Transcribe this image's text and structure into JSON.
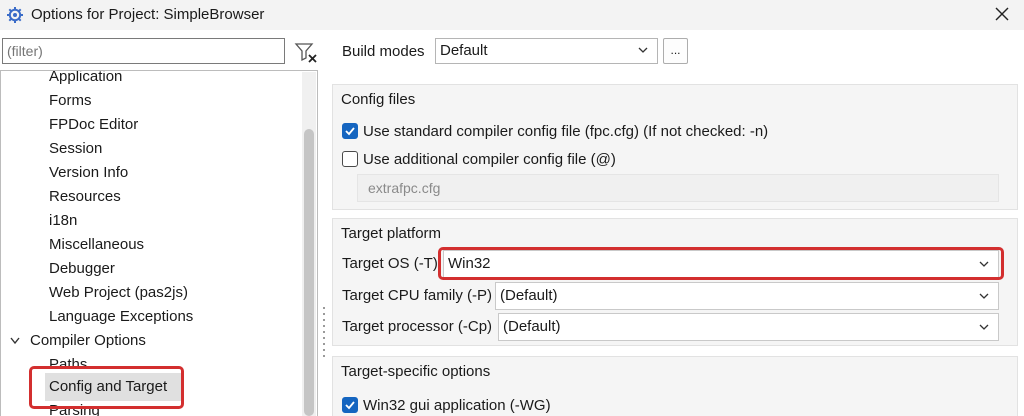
{
  "window": {
    "title": "Options for Project: SimpleBrowser"
  },
  "filter": {
    "placeholder": "(filter)"
  },
  "tree": {
    "items": [
      "Application",
      "Forms",
      "FPDoc Editor",
      "Session",
      "Version Info",
      "Resources",
      "i18n",
      "Miscellaneous",
      "Debugger",
      "Web Project (pas2js)",
      "Language Exceptions",
      "Compiler Options",
      "Paths",
      "Config and Target",
      "Parsing"
    ],
    "selected": "Config and Target"
  },
  "build_modes": {
    "label": "Build modes",
    "value": "Default",
    "more_label": "..."
  },
  "config_files": {
    "title": "Config files",
    "use_standard": {
      "label": "Use standard compiler config file (fpc.cfg) (If not checked: -n)",
      "checked": true
    },
    "use_additional": {
      "label": "Use additional compiler config file (@)",
      "checked": false
    },
    "additional_value": "extrafpc.cfg"
  },
  "target_platform": {
    "title": "Target platform",
    "os": {
      "label": "Target OS (-T)",
      "value": "Win32"
    },
    "cpu": {
      "label": "Target CPU family (-P)",
      "value": "(Default)"
    },
    "processor": {
      "label": "Target processor (-Cp)",
      "value": "(Default)"
    }
  },
  "target_specific": {
    "title": "Target-specific options",
    "win32_gui": {
      "label": "Win32 gui application (-WG)",
      "checked": true
    }
  },
  "colors": {
    "highlight": "#d32f2f",
    "accent": "#1565c0"
  }
}
